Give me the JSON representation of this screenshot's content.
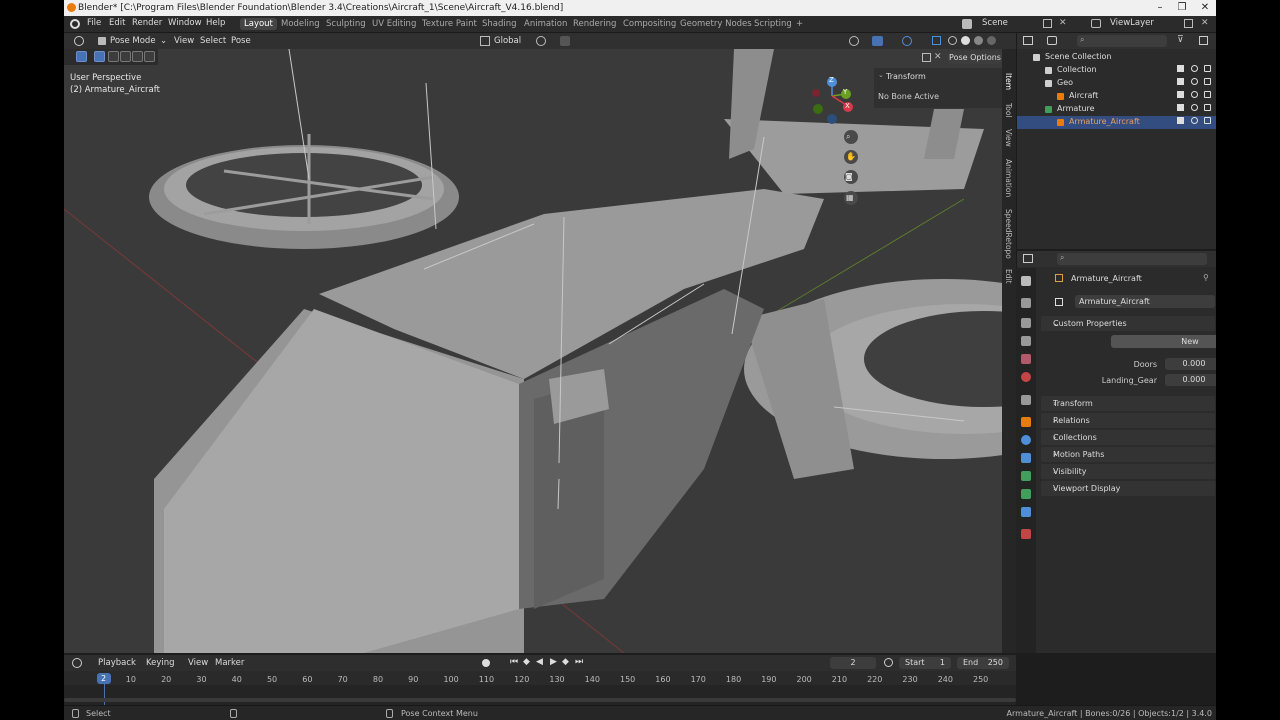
{
  "window": {
    "title": "Blender* [C:\\Program Files\\Blender Foundation\\Blender 3.4\\Creations\\Aircraft_1\\Scene\\Aircraft_V4.16.blend]"
  },
  "menubar": {
    "items": [
      "File",
      "Edit",
      "Render",
      "Window",
      "Help"
    ],
    "workspaces": [
      "Layout",
      "Modeling",
      "Sculpting",
      "UV Editing",
      "Texture Paint",
      "Shading",
      "Animation",
      "Rendering",
      "Compositing",
      "Geometry Nodes",
      "Scripting"
    ],
    "active_workspace": "Layout",
    "add_label": "+",
    "scene": "Scene",
    "view_layer": "ViewLayer"
  },
  "viewport_header": {
    "mode": "Pose Mode",
    "menus": [
      "View",
      "Select",
      "Pose"
    ],
    "orientation": "Global",
    "pose_options": "Pose Options"
  },
  "viewport": {
    "view_name": "User Perspective",
    "object_name": "(2) Armature_Aircraft",
    "gizmo_labels": [
      "Z",
      "Y",
      "X"
    ]
  },
  "npanel": {
    "title": "Transform",
    "message": "No Bone Active",
    "tabs": [
      "Item",
      "Tool",
      "View",
      "Animation",
      "SpeedRetopo",
      "Edit"
    ]
  },
  "outliner": {
    "rows": [
      {
        "label": "Scene Collection",
        "indent": 0,
        "selected": false
      },
      {
        "label": "Collection",
        "indent": 1,
        "selected": false
      },
      {
        "label": "Geo",
        "indent": 1,
        "selected": false
      },
      {
        "label": "Aircraft",
        "indent": 2,
        "selected": false
      },
      {
        "label": "Armature",
        "indent": 1,
        "selected": false
      },
      {
        "label": "Armature_Aircraft",
        "indent": 2,
        "selected": true
      }
    ]
  },
  "properties": {
    "object_name": "Armature_Aircraft",
    "data_name": "Armature_Aircraft",
    "custom_properties_label": "Custom Properties",
    "new_button": "New",
    "custom_props": [
      {
        "name": "Doors",
        "value": "0.000"
      },
      {
        "name": "Landing_Gear",
        "value": "0.000"
      }
    ],
    "sections": [
      "Transform",
      "Relations",
      "Collections",
      "Motion Paths",
      "Visibility",
      "Viewport Display"
    ]
  },
  "timeline": {
    "menus": [
      "Playback",
      "Keying",
      "View",
      "Marker"
    ],
    "current_frame": "2",
    "start_label": "Start",
    "start": "1",
    "end_label": "End",
    "end": "250",
    "ticks": [
      "10",
      "20",
      "30",
      "40",
      "50",
      "60",
      "70",
      "80",
      "90",
      "100",
      "110",
      "120",
      "130",
      "140",
      "150",
      "160",
      "170",
      "180",
      "190",
      "200",
      "210",
      "220",
      "230",
      "240",
      "250"
    ],
    "playhead_value": 2
  },
  "statusbar": {
    "left": "Select",
    "middle": "Pose Context Menu",
    "right": "Armature_Aircraft | Bones:0/26 | Objects:1/2 | 3.4.0"
  }
}
